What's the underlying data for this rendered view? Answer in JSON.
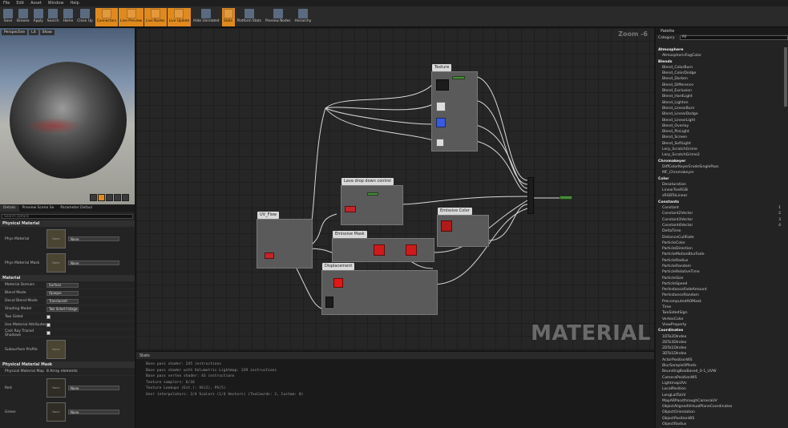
{
  "menu": [
    "File",
    "Edit",
    "Asset",
    "Window",
    "Help"
  ],
  "toolbar": [
    {
      "label": "Save",
      "hl": false
    },
    {
      "label": "Browse",
      "hl": false
    },
    {
      "label": "Apply",
      "hl": false
    },
    {
      "label": "Search",
      "hl": false
    },
    {
      "label": "Home",
      "hl": false
    },
    {
      "label": "Clean Up",
      "hl": false
    },
    {
      "label": "Connectors",
      "hl": true
    },
    {
      "label": "Live Preview",
      "hl": true
    },
    {
      "label": "Live Nodes",
      "hl": true
    },
    {
      "label": "Live Update",
      "hl": true
    },
    {
      "label": "Hide Unrelated",
      "hl": false
    },
    {
      "label": "Stats",
      "hl": true
    },
    {
      "label": "Platform Stats",
      "hl": false
    },
    {
      "label": "Preview Nodes",
      "hl": false
    },
    {
      "label": "Hierarchy",
      "hl": false
    }
  ],
  "viewport": {
    "perspective": "Perspective",
    "lit": "Lit",
    "show": "Show"
  },
  "left_tabs": [
    "Details",
    "Preview Scene Se",
    "Parameter Defaul"
  ],
  "details": {
    "search_placeholder": "Search Details",
    "cat_physical": "Physical Material",
    "phys_material": "Phys Material",
    "phys_material_mask": "Phys Material Mask",
    "none": "None",
    "cat_material": "Material",
    "rows": [
      {
        "label": "Material Domain",
        "value": "Surface"
      },
      {
        "label": "Blend Mode",
        "value": "Opaque"
      },
      {
        "label": "Decal Blend Mode",
        "value": "Translucent"
      },
      {
        "label": "Shading Model",
        "value": "Two Sided Foliage"
      }
    ],
    "checks": [
      "Two Sided",
      "Use Material Attributes",
      "Cast Ray Traced Shadows"
    ],
    "subsurface": "Subsurface Profile",
    "cat_mask": "Physical Material Mask",
    "mask_map": "Physical Material Map",
    "mask_count": "8 Array elements",
    "red": "Red",
    "green": "Green"
  },
  "graph": {
    "zoom": "Zoom -6",
    "watermark": "MATERIAL",
    "comments": {
      "texture": "Texture",
      "lava": "Lava drop down control",
      "uv": "UV_Flow",
      "emissive_mask": "Emissive Mask",
      "emissive_color": "Emissive Color",
      "displacement": "Displacement"
    }
  },
  "stats": {
    "title": "Stats",
    "lines": [
      "Base pass shader: 245 instructions",
      "Base pass shader with Volumetric Lightmap: 339 instructions",
      "Base pass vertex shader: 43 instructions",
      "Texture samplers: 6/16",
      "Texture Lookups (Est.): VS(2), PS(5)",
      "User interpolators: 2/4 Scalars (1/4 Vectors) (TexCoords: 2, Custom: 0)"
    ]
  },
  "palette": {
    "title": "Palette",
    "category_label": "Category",
    "category_value": "All",
    "items": [
      {
        "t": "Atmosphere",
        "c": true
      },
      {
        "t": "AtmosphericFogColor"
      },
      {
        "t": "Blends",
        "c": true
      },
      {
        "t": "Blend_ColorBurn"
      },
      {
        "t": "Blend_ColorDodge"
      },
      {
        "t": "Blend_Darken"
      },
      {
        "t": "Blend_Difference"
      },
      {
        "t": "Blend_Exclusion"
      },
      {
        "t": "Blend_HardLight"
      },
      {
        "t": "Blend_Lighten"
      },
      {
        "t": "Blend_LinearBurn"
      },
      {
        "t": "Blend_LinearDodge"
      },
      {
        "t": "Blend_LinearLight"
      },
      {
        "t": "Blend_Overlay"
      },
      {
        "t": "Blend_PinLight"
      },
      {
        "t": "Blend_Screen"
      },
      {
        "t": "Blend_SoftLight"
      },
      {
        "t": "Lerp_ScratchGrime"
      },
      {
        "t": "Lerp_ScratchGrime2"
      },
      {
        "t": "Chromakeyer",
        "c": true
      },
      {
        "t": "DiffColorKeyerErodeSinglePass"
      },
      {
        "t": "MF_Chromakeyer"
      },
      {
        "t": "Color",
        "c": true
      },
      {
        "t": "Desaturation"
      },
      {
        "t": "LinearToeRGB"
      },
      {
        "t": "sRGBToLinear"
      },
      {
        "t": "Constants",
        "c": true
      },
      {
        "t": "Constant",
        "k": "1"
      },
      {
        "t": "Constant2Vector",
        "k": "2"
      },
      {
        "t": "Constant3Vector",
        "k": "3"
      },
      {
        "t": "Constant4Vector",
        "k": "4"
      },
      {
        "t": "DeltaTime"
      },
      {
        "t": "DistanceCullFade"
      },
      {
        "t": "ParticleColor"
      },
      {
        "t": "ParticleDirection"
      },
      {
        "t": "ParticleMotionBlurFade"
      },
      {
        "t": "ParticleRadius"
      },
      {
        "t": "ParticleRandom"
      },
      {
        "t": "ParticleRelativeTime"
      },
      {
        "t": "ParticleSize"
      },
      {
        "t": "ParticleSpeed"
      },
      {
        "t": "PerInstanceFadeAmount"
      },
      {
        "t": "PerInstanceRandom"
      },
      {
        "t": "PrecomputedAOMask"
      },
      {
        "t": "Time"
      },
      {
        "t": "TwoSidedSign"
      },
      {
        "t": "VertexColor"
      },
      {
        "t": "ViewProperty"
      },
      {
        "t": "Coordinates",
        "c": true
      },
      {
        "t": "1DTo2DIndex"
      },
      {
        "t": "2DTo3DIndex"
      },
      {
        "t": "2DTo1DIndex"
      },
      {
        "t": "3DTo1DIndex"
      },
      {
        "t": "ActorPositionWS"
      },
      {
        "t": "BlurSampleOffsets"
      },
      {
        "t": "BoundingBoxBased_0-1_UVW"
      },
      {
        "t": "CameraPositionWS"
      },
      {
        "t": "LightmapUVs"
      },
      {
        "t": "LocalPosition"
      },
      {
        "t": "LongLatToUV"
      },
      {
        "t": "MapARPassthroughCameraUV"
      },
      {
        "t": "ObjectAlignedVirtualPlaneCoordinates"
      },
      {
        "t": "ObjectOrientation"
      },
      {
        "t": "ObjectPositionWS"
      },
      {
        "t": "ObjectRadius"
      }
    ]
  }
}
